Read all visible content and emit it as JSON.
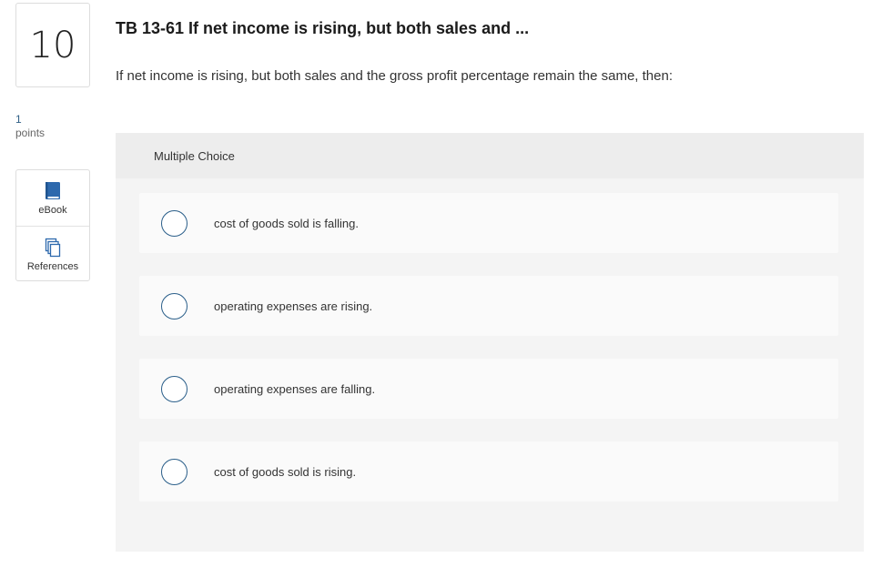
{
  "question": {
    "number": "10",
    "points_value": "1",
    "points_label": "points",
    "title": "TB 13-61 If net income is rising, but both sales and ...",
    "text": "If net income is rising, but both sales and the gross profit percentage remain the same, then:"
  },
  "tools": [
    {
      "label": "eBook",
      "icon": "book-icon"
    },
    {
      "label": "References",
      "icon": "documents-icon"
    }
  ],
  "mc": {
    "header": "Multiple Choice",
    "options": [
      {
        "label": "cost of goods sold is falling."
      },
      {
        "label": "operating expenses are rising."
      },
      {
        "label": "operating expenses are falling."
      },
      {
        "label": "cost of goods sold is rising."
      }
    ]
  },
  "colors": {
    "accent": "#2b5f8a",
    "panel": "#f4f4f4",
    "panel_header": "#ededed",
    "option_bg": "#fafafa"
  }
}
